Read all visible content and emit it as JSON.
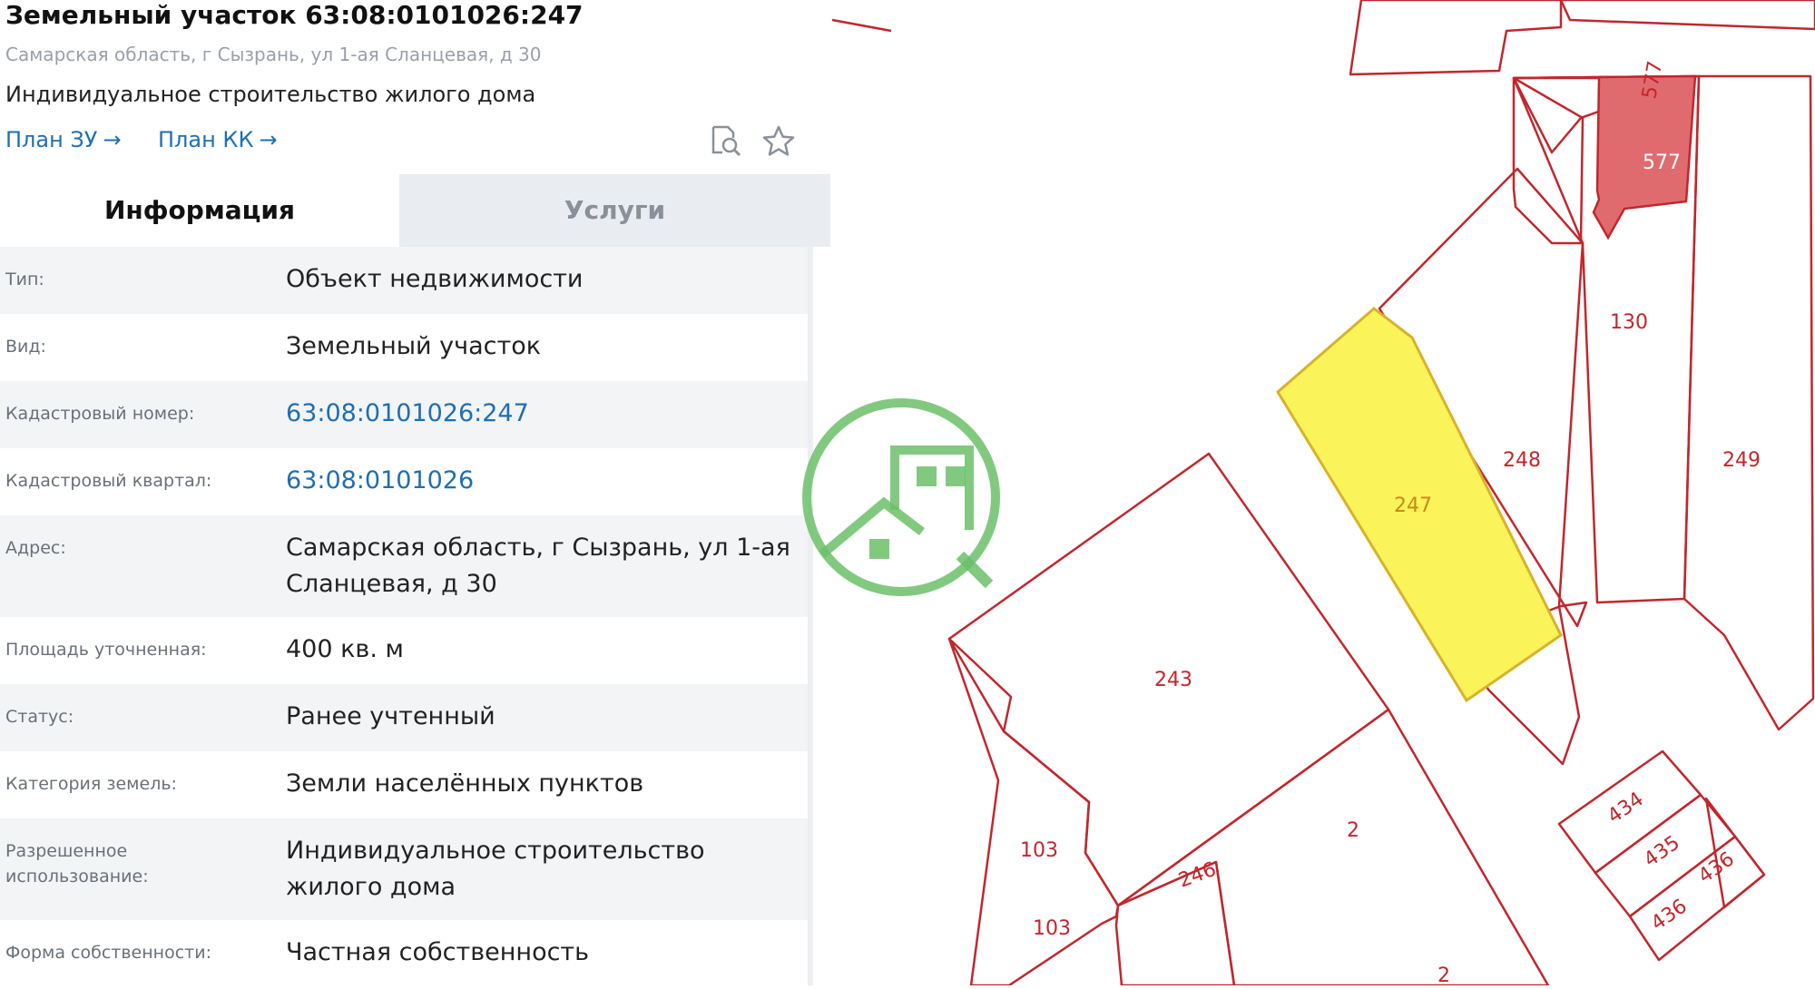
{
  "header": {
    "title": "Земельный участок 63:08:0101026:247",
    "address": "Самарская область, г Сызрань, ул 1-ая Сланцевая, д 30",
    "purpose": "Индивидуальное строительство жилого дома",
    "plan_zu": "План ЗУ",
    "plan_kk": "План КК",
    "arrow": "→"
  },
  "tabs": {
    "info": "Информация",
    "services": "Услуги"
  },
  "rows": [
    {
      "label": "Тип:",
      "value": "Объект недвижимости"
    },
    {
      "label": "Вид:",
      "value": "Земельный участок"
    },
    {
      "label": "Кадастровый номер:",
      "value": "63:08:0101026:247"
    },
    {
      "label": "Кадастровый квартал:",
      "value": "63:08:0101026"
    },
    {
      "label": "Адрес:",
      "value": "Самарская область, г Сызрань, ул 1-ая Сланцевая, д 30"
    },
    {
      "label": "Площадь уточненная:",
      "value": "400 кв. м"
    },
    {
      "label": "Статус:",
      "value": "Ранее учтенный"
    },
    {
      "label": "Категория земель:",
      "value": "Земли населённых пунктов"
    },
    {
      "label": "Разрешенное использование:",
      "value": "Индивидуальное строительство жилого дома"
    },
    {
      "label": "Форма собственности:",
      "value": "Частная собственность"
    }
  ],
  "map": {
    "parcel_labels": {
      "p577a": "577",
      "p577b": "577",
      "p130": "130",
      "p248": "248",
      "p249": "249",
      "p247": "247",
      "p243": "243",
      "p2": "2",
      "p2b": "2",
      "p434": "434",
      "p435": "435",
      "p436a": "436",
      "p436b": "436",
      "p103a": "103",
      "p103b": "103",
      "p246": "246"
    },
    "colors": {
      "boundary": "#c0272d",
      "selected_fill": "#fbf35a",
      "selected_stroke": "#d6b32a",
      "highlight_fill": "#e06b6e",
      "logo": "#6cbf6a"
    }
  }
}
